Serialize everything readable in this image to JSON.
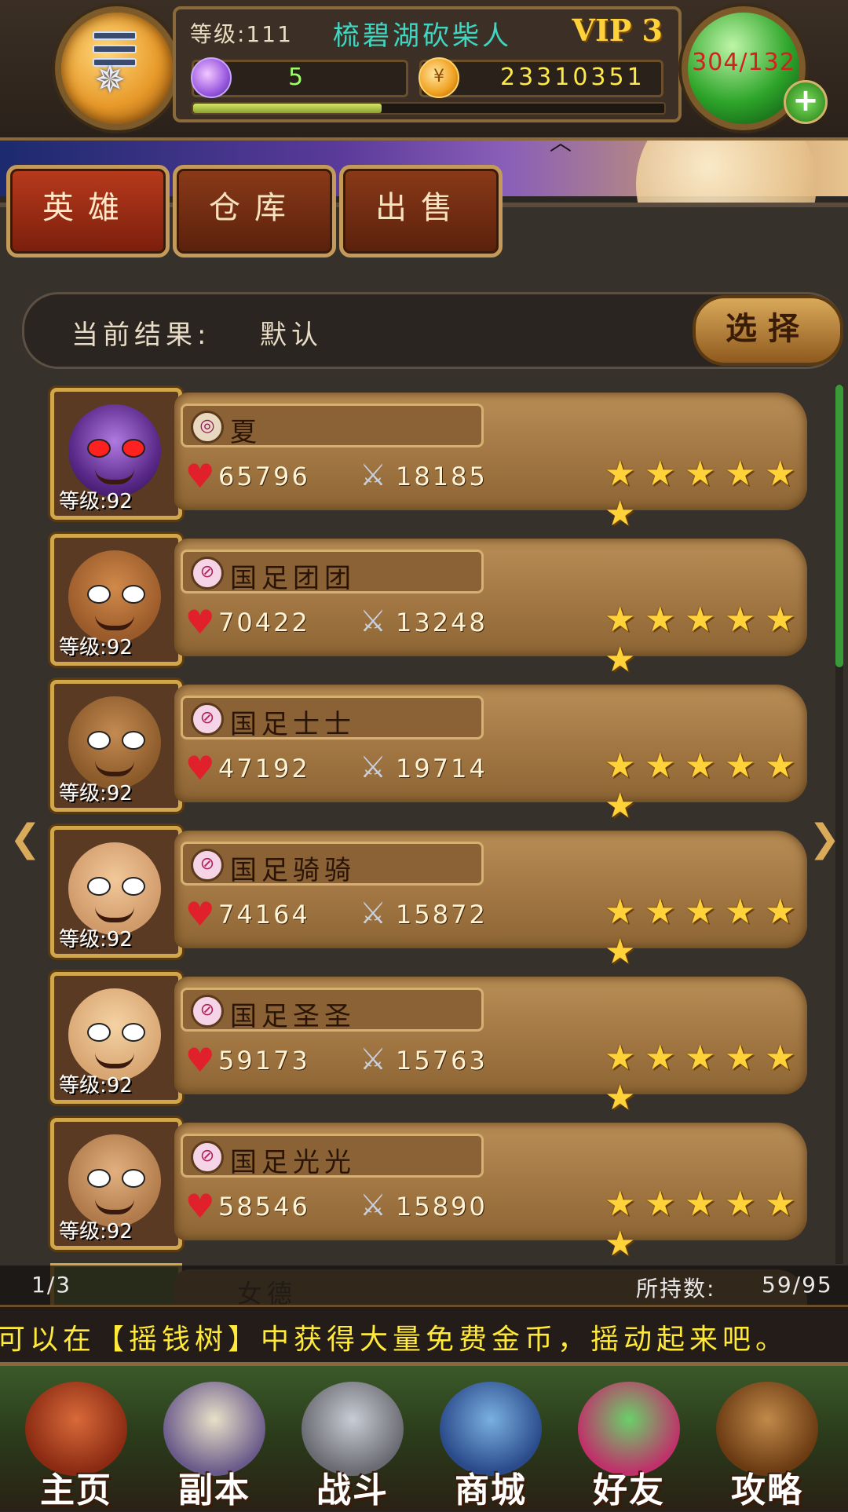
{
  "header": {
    "level_label": "等级:111",
    "player_name": "梳碧湖砍柴人",
    "vip": "VIP 3",
    "gems": "5",
    "gold": "23310351",
    "exp_fraction": 0.4,
    "stamina": "304/132",
    "plus_symbol": "+"
  },
  "tabs": [
    {
      "label": "英雄",
      "active": true
    },
    {
      "label": "仓库",
      "active": false
    },
    {
      "label": "出售",
      "active": false
    }
  ],
  "filter": {
    "label": "当前结果:",
    "value": "默认",
    "select_label": "选择"
  },
  "heroes": [
    {
      "name": "夏",
      "level": "等级:92",
      "hp": "65796",
      "atk": "18185",
      "stars": 6,
      "class_icon": "shell-icon"
    },
    {
      "name": "国足团团",
      "level": "等级:92",
      "hp": "70422",
      "atk": "13248",
      "stars": 6,
      "class_icon": "spear-badge-icon"
    },
    {
      "name": "国足士士",
      "level": "等级:92",
      "hp": "47192",
      "atk": "19714",
      "stars": 6,
      "class_icon": "spear-badge-icon"
    },
    {
      "name": "国足骑骑",
      "level": "等级:92",
      "hp": "74164",
      "atk": "15872",
      "stars": 6,
      "class_icon": "spear-badge-icon"
    },
    {
      "name": "国足圣圣",
      "level": "等级:92",
      "hp": "59173",
      "atk": "15763",
      "stars": 6,
      "class_icon": "spear-badge-icon"
    },
    {
      "name": "国足光光",
      "level": "等级:92",
      "hp": "58546",
      "atk": "15890",
      "stars": 6,
      "class_icon": "spear-badge-icon"
    }
  ],
  "partial_hero_name": "女德",
  "footer": {
    "page": "1/3",
    "hold_label": "所持数:",
    "hold_value": "59/95"
  },
  "ticker": "可以在【摇钱树】中获得大量免费金币，摇动起来吧。",
  "nav": [
    {
      "label": "主页",
      "icon": "house-icon"
    },
    {
      "label": "副本",
      "icon": "skull-icon"
    },
    {
      "label": "战斗",
      "icon": "sword-icon"
    },
    {
      "label": "商城",
      "icon": "monster-shop-icon"
    },
    {
      "label": "好友",
      "icon": "friends-icon"
    },
    {
      "label": "攻略",
      "icon": "guide-book-icon"
    }
  ],
  "colors": {
    "gold_text": "#ffe94a",
    "gem_text": "#9cff6a",
    "name_text": "#3fd6c2",
    "stamina_text": "#d22020",
    "star": "#ffd23a",
    "tab_active": "#b83a1c"
  }
}
